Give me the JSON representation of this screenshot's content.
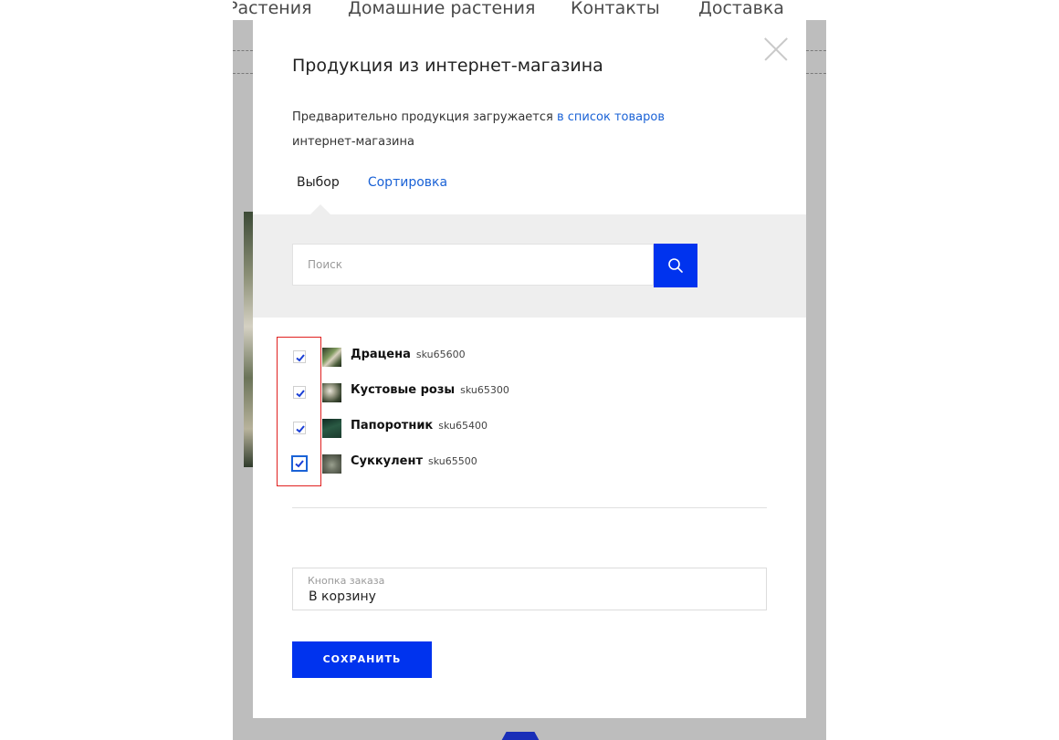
{
  "background": {
    "nav_items": [
      "Растения",
      "Домашние растения",
      "Контакты",
      "Доставка"
    ]
  },
  "modal": {
    "title": "Продукция из интернет-магазина",
    "description_text": "Предварительно продукция загружается",
    "description_link": "в список товаров",
    "description_tail": "интернет-магазина",
    "tabs": [
      {
        "label": "Выбор",
        "active": true
      },
      {
        "label": "Сортировка",
        "active": false
      }
    ],
    "search": {
      "placeholder": "Поиск",
      "value": ""
    },
    "products": [
      {
        "name": "Драцена",
        "sku": "sku65600",
        "checked": true
      },
      {
        "name": "Кустовые розы",
        "sku": "sku65300",
        "checked": true
      },
      {
        "name": "Папоротник",
        "sku": "sku65400",
        "checked": true
      },
      {
        "name": "Суккулент",
        "sku": "sku65500",
        "checked": true
      }
    ],
    "order_button_field": {
      "label": "Кнопка заказа",
      "value": "В корзину"
    },
    "save_label": "СОХРАНИТЬ"
  },
  "colors": {
    "accent": "#0033ee",
    "link": "#1a62d6",
    "highlight": "#e0201f",
    "overlay": "#bdbdbd"
  }
}
